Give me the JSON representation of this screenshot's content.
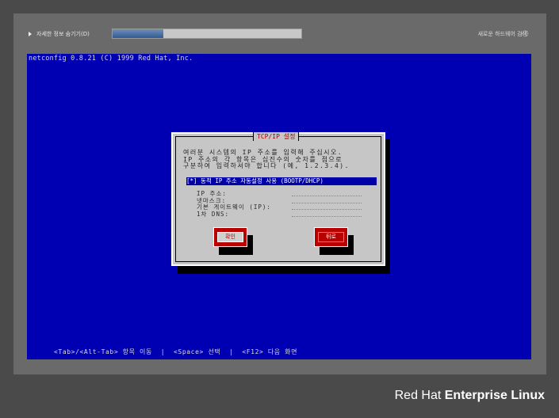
{
  "topbar": {
    "toggle_label": "자세한 정보 숨기기(D)",
    "progress_fraction": 0.27,
    "hardware_label": "새로운 하드웨어 검색"
  },
  "console": {
    "version_text": "netconfig 0.8.21 (C) 1999 Red Hat, Inc.",
    "dialog": {
      "title": "TCP/IP 설정",
      "description": "여러분 시스템의 IP 주소를 입력해 주십시오.\nIP 주소의 각 항목은 십진수의 숫자를 점으로\n구분하여 입력하셔야 합니다 (예, 1.2.3.4).",
      "dhcp_option": "[*] 동적 IP 주소 자동설정 사용 (BOOTP/DHCP)",
      "fields": [
        {
          "label": "IP 주소:",
          "value": ""
        },
        {
          "label": "넷마스크:",
          "value": ""
        },
        {
          "label": "기본 게이트웨이 (IP):",
          "value": ""
        },
        {
          "label": "1차 DNS:",
          "value": ""
        }
      ],
      "ok_label": "확인",
      "back_label": "뒤로"
    },
    "bottom_hint": "<Tab>/<Alt-Tab> 항목 이동  |  <Space> 선택  |  <F12> 다음 화면"
  },
  "brand": {
    "regular": "Red Hat ",
    "bold": "Enterprise Linux"
  },
  "icons": {
    "toggle": "triangle-right-icon",
    "spinner": "spinner-icon"
  },
  "colors": {
    "console_bg": "#0000b2",
    "dialog_bg": "#c6c6c6",
    "button_red": "#b80000",
    "title_red": "#b00000"
  }
}
